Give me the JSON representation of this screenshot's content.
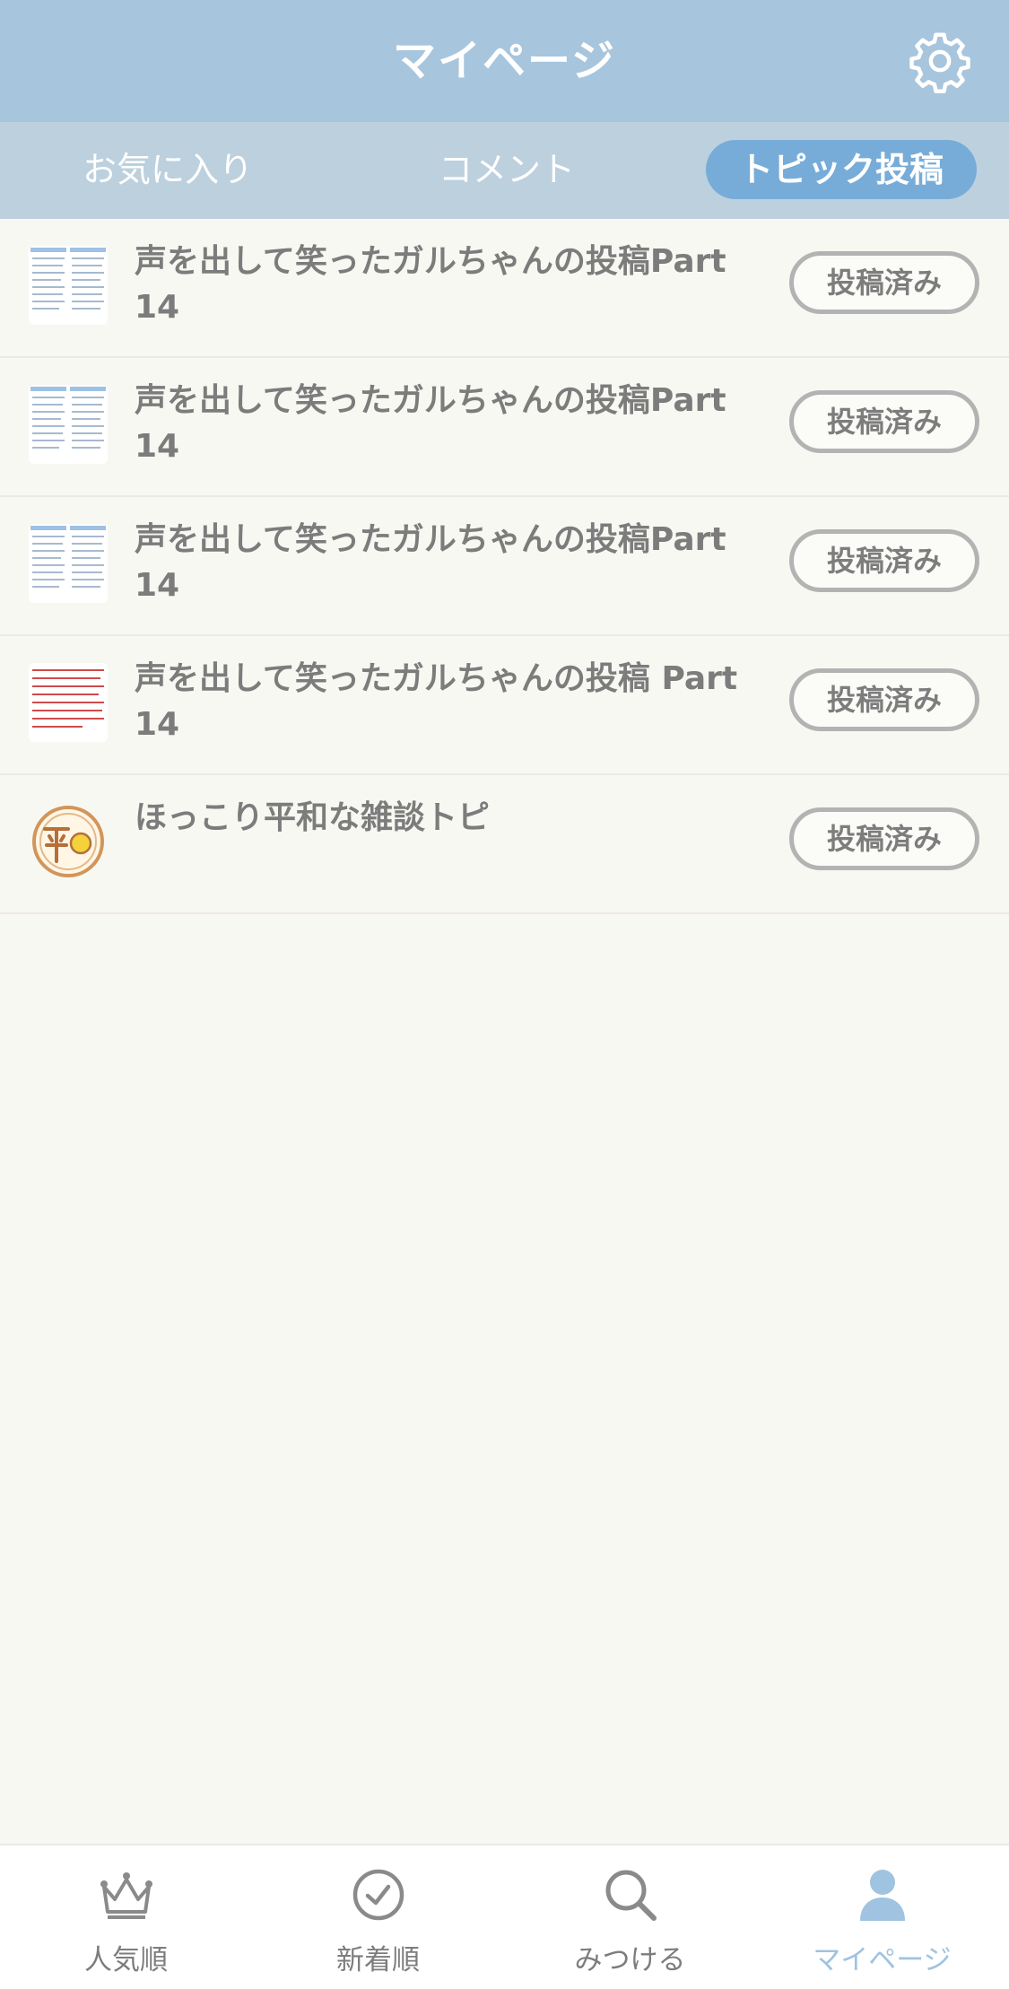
{
  "header": {
    "title": "マイページ",
    "settings_icon": "gear-icon"
  },
  "tabs": [
    {
      "label": "お気に入り",
      "active": false
    },
    {
      "label": "コメント",
      "active": false
    },
    {
      "label": "トピック投稿",
      "active": true
    }
  ],
  "topics": [
    {
      "title": "声を出して笑ったガルちゃんの投稿Part14",
      "status": "投稿済み",
      "thumbnail": "text-grid"
    },
    {
      "title": "声を出して笑ったガルちゃんの投稿Part14",
      "status": "投稿済み",
      "thumbnail": "text-grid"
    },
    {
      "title": "声を出して笑ったガルちゃんの投稿Part 14",
      "status": "投稿済み",
      "thumbnail": "text-grid"
    },
    {
      "title": "声を出して笑ったガルちゃんの投稿 Part 14",
      "status": "投稿済み",
      "thumbnail": "red-text"
    },
    {
      "title": "ほっこり平和な雑談トピ",
      "status": "投稿済み",
      "thumbnail": "heiwa-logo"
    }
  ],
  "bottom_nav": [
    {
      "label": "人気順",
      "icon": "crown-icon",
      "active": false
    },
    {
      "label": "新着順",
      "icon": "clock-icon",
      "active": false
    },
    {
      "label": "みつける",
      "icon": "search-icon",
      "active": false
    },
    {
      "label": "マイページ",
      "icon": "person-icon",
      "active": true
    }
  ],
  "colors": {
    "header_bg": "#a7c5dd",
    "tabs_bg": "#bcd0de",
    "active_tab": "#77acd8",
    "active_nav": "#9fc3e0"
  }
}
